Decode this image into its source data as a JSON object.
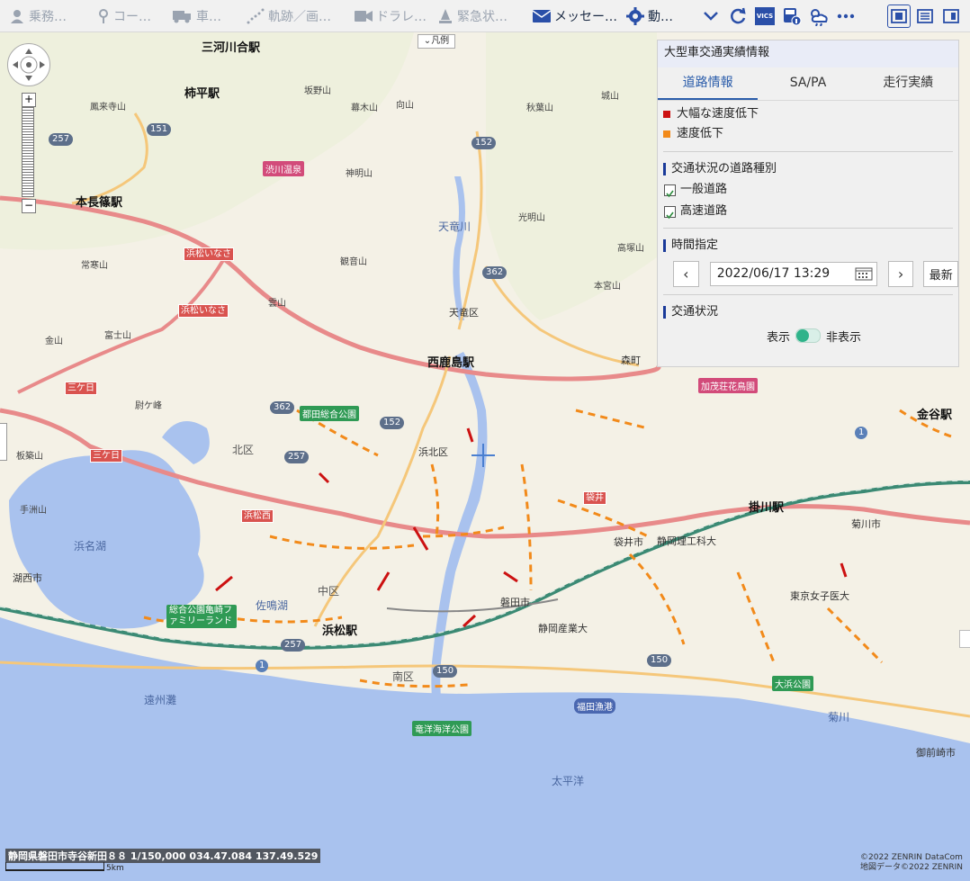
{
  "toolbar": {
    "items": [
      {
        "label": "乗務…",
        "icon": "person-icon"
      },
      {
        "label": "コー…",
        "icon": "map-pin-icon"
      },
      {
        "label": "車…",
        "icon": "truck-icon"
      },
      {
        "label": "軌跡／画…",
        "icon": "track-icon"
      },
      {
        "label": "ドラレ…",
        "icon": "video-icon"
      },
      {
        "label": "緊急状…",
        "icon": "alert-icon"
      },
      {
        "label": "メッセー…",
        "icon": "mail-icon"
      },
      {
        "label": "動…",
        "icon": "gear-icon"
      }
    ],
    "vics_label": "VICS"
  },
  "map": {
    "legend_button": "凡例",
    "stations": [
      "三河川合駅",
      "柿平駅",
      "本長篠駅",
      "西鹿島駅",
      "浜松駅",
      "掛川駅",
      "金谷駅"
    ],
    "districts": [
      "北区",
      "中区",
      "南区",
      "浜北区",
      "天竜区"
    ],
    "water": [
      "浜名湖",
      "遠州灘",
      "太平洋",
      "天竜川",
      "佐鳴湖",
      "菊川"
    ],
    "routes": [
      "257",
      "151",
      "152",
      "362",
      "150",
      "1"
    ],
    "places": [
      "湖西市",
      "磐田市",
      "袋井市",
      "菊川市",
      "御前崎市",
      "森町",
      "手洲山",
      "板築山"
    ],
    "facilities": [
      "総合公園亀崎ファミリーランド",
      "竜洋海洋公園",
      "福田漁港",
      "都田総合公園",
      "加茂荘花鳥園",
      "大浜公園",
      "渋川温泉"
    ],
    "universities": [
      "静岡理工科大",
      "静岡産業大",
      "東京女子医大"
    ],
    "ic_labels": [
      "浜松いなさ",
      "浜松いなさ",
      "三ケ日",
      "三ケ日",
      "浜松西",
      "袋井"
    ],
    "mountains": [
      "鳳来寺山",
      "坂野山",
      "幕木山",
      "向山",
      "秋葉山",
      "城山",
      "神明山",
      "光明山",
      "常寒山",
      "観音山",
      "高塚山",
      "本宮山",
      "雲山",
      "金山",
      "富士山",
      "尉ケ峰"
    ]
  },
  "panel": {
    "title": "大型車交通実績情報",
    "tabs": [
      "道路情報",
      "SA/PA",
      "走行実績"
    ],
    "legend": [
      {
        "label": "大幅な速度低下",
        "color": "#cc1111"
      },
      {
        "label": "速度低下",
        "color": "#f28a1a"
      }
    ],
    "road_type_heading": "交通状況の道路種別",
    "road_types": [
      {
        "label": "一般道路",
        "checked": true
      },
      {
        "label": "高速道路",
        "checked": true
      }
    ],
    "time_heading": "時間指定",
    "datetime": "2022/06/17 13:29",
    "latest_button": "最新",
    "traffic_heading": "交通状況",
    "toggle_on": "表示",
    "toggle_off": "非表示"
  },
  "status": {
    "address_coords": "静岡県磐田市寺谷新田８８ 1/150,000 034.47.084 137.49.529",
    "scale": "5km",
    "copyright1": "©2022 ZENRIN DataCom",
    "copyright2": "地図データ©2022 ZENRIN"
  }
}
